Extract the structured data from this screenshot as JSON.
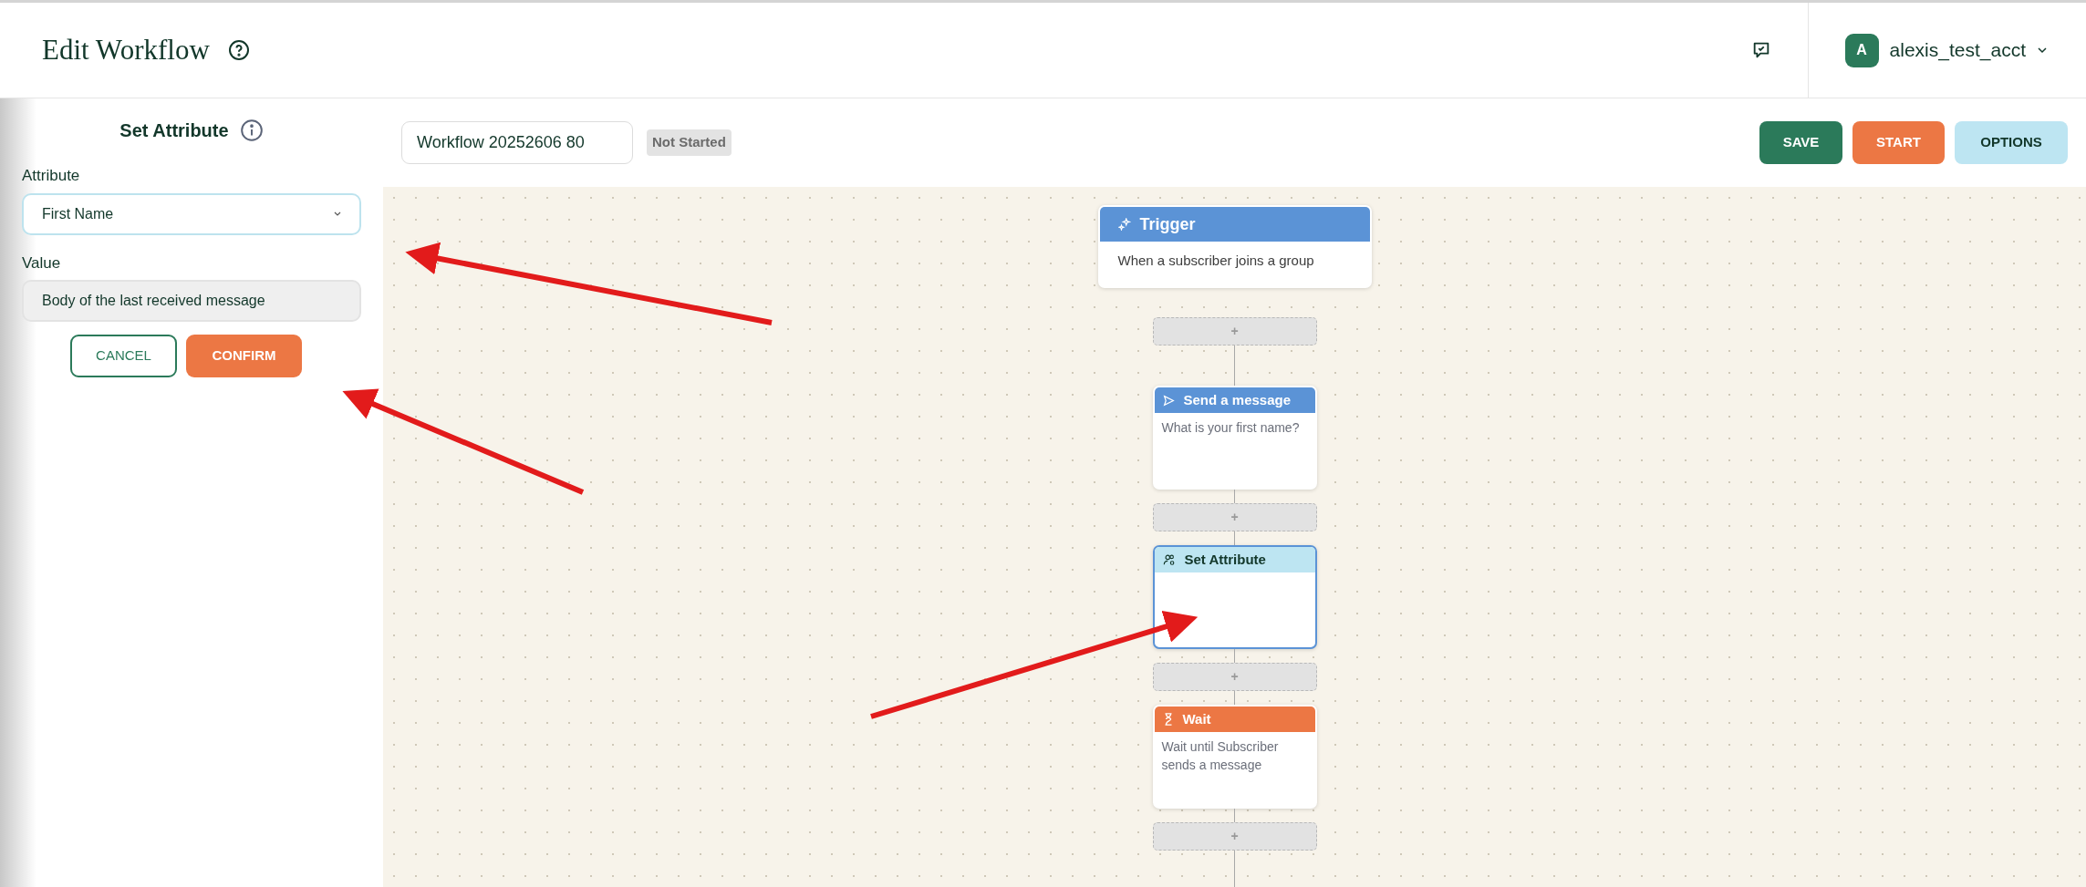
{
  "header": {
    "title": "Edit Workflow",
    "account": {
      "initial": "A",
      "name": "alexis_test_acct"
    }
  },
  "panel": {
    "title": "Set Attribute",
    "fields": [
      {
        "label": "Attribute",
        "kind": "select",
        "value": "First Name"
      },
      {
        "label": "Value",
        "kind": "readonly",
        "value": "Body of the last received message"
      }
    ],
    "buttons": [
      {
        "label": "CANCEL",
        "kind": "outline"
      },
      {
        "label": "CONFIRM",
        "kind": "primary"
      }
    ]
  },
  "toolbar": {
    "workflow_name": "Workflow 20252606 80",
    "status": "Not Started",
    "buttons": [
      {
        "label": "SAVE",
        "kind": "save"
      },
      {
        "label": "START",
        "kind": "start"
      },
      {
        "label": "OPTIONS",
        "kind": "options"
      }
    ]
  },
  "canvas": {
    "steps": [
      {
        "kind": "trigger",
        "title": "Trigger",
        "body": "When a subscriber joins a group",
        "selected": false
      },
      {
        "kind": "add",
        "label": "+"
      },
      {
        "kind": "send_message",
        "title": "Send a message",
        "body": "What is your first name?",
        "selected": false
      },
      {
        "kind": "add",
        "label": "+"
      },
      {
        "kind": "set_attribute",
        "title": "Set Attribute",
        "selected": true
      },
      {
        "kind": "add",
        "label": "+"
      },
      {
        "kind": "wait",
        "title": "Wait",
        "body": "Wait until Subscriber sends a message",
        "selected": false
      },
      {
        "kind": "add",
        "label": "+"
      }
    ]
  }
}
